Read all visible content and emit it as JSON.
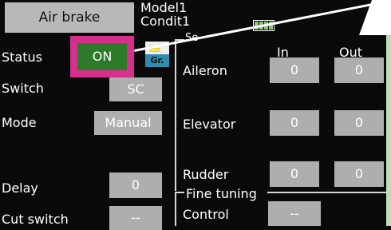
{
  "header": {
    "title_button": "Air brake",
    "model_line1": "Model1",
    "model_line2": "Condit1"
  },
  "left": {
    "status_label": "Status",
    "status_value": "ON",
    "group_tag": "Gr.",
    "switch_label": "Switch",
    "switch_value": "SC",
    "mode_label": "Mode",
    "mode_value": "Manual",
    "delay_label": "Delay",
    "delay_value": "0",
    "cut_switch_label": "Cut switch",
    "cut_switch_value": "--"
  },
  "table": {
    "group_label_fragment": "Se",
    "col_in": "In",
    "col_out": "Out",
    "rows": [
      {
        "label": "Aileron",
        "in": "0",
        "out": "0"
      },
      {
        "label": "Elevator",
        "in": "0",
        "out": "0"
      },
      {
        "label": "Rudder",
        "in": "0",
        "out": "0"
      }
    ]
  },
  "fine_tuning": {
    "title": "Fine tuning",
    "control_label": "Control",
    "control_value": "--"
  },
  "colors": {
    "highlight_border": "#d62f8d",
    "on_green": "#2e7a28",
    "button_gray": "#aeaeae",
    "outer_green": "#b7e1b1"
  }
}
